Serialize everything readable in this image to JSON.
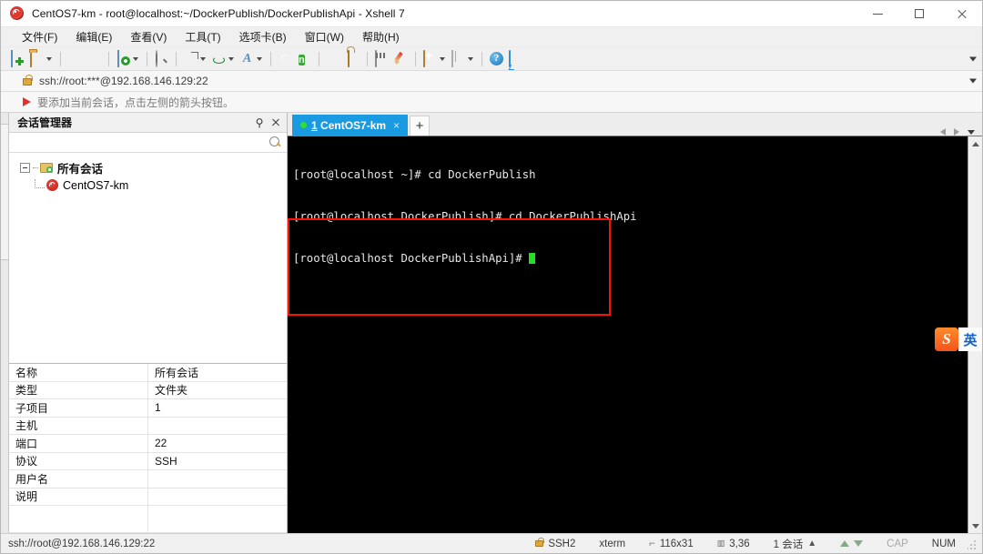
{
  "window": {
    "title": "CentOS7-km - root@localhost:~/DockerPublish/DockerPublishApi - Xshell 7",
    "app_icon": "xshell-spiral-icon",
    "minimize_label": "",
    "maximize_label": "",
    "close_label": ""
  },
  "menu": {
    "items": [
      {
        "label": "文件(F)",
        "name": "menu-file"
      },
      {
        "label": "编辑(E)",
        "name": "menu-edit"
      },
      {
        "label": "查看(V)",
        "name": "menu-view"
      },
      {
        "label": "工具(T)",
        "name": "menu-tools"
      },
      {
        "label": "选项卡(B)",
        "name": "menu-tabs"
      },
      {
        "label": "窗口(W)",
        "name": "menu-window"
      },
      {
        "label": "帮助(H)",
        "name": "menu-help"
      }
    ]
  },
  "toolbar": {
    "icons": [
      "new-session-icon",
      "open-folder-icon",
      "disconnect-icon",
      "link-icon",
      "session-properties-icon",
      "find-icon",
      "file-transfer-icon",
      "globe-icon",
      "font-icon",
      "xshell-icon",
      "nfs-icon",
      "fullscreen-icon",
      "lock-icon",
      "keyboard-icon",
      "highlight-pen-icon",
      "new-folder-icon",
      "layout-icon",
      "help-icon",
      "chat-icon"
    ],
    "nfs_glyph": "n",
    "font_glyph": "A",
    "help_glyph": "?",
    "overflow_name": "toolbar-overflow-chevron"
  },
  "address_bar": {
    "value": "ssh://root:***@192.168.146.129:22",
    "lock_icon": "lock-icon",
    "overflow_name": "address-overflow-chevron"
  },
  "hint_bar": {
    "text": "要添加当前会话，点击左侧的箭头按钮。",
    "icon": "red-flag-icon"
  },
  "sidebar": {
    "title": "会话管理器",
    "pin_label": "⚲",
    "close_label": "✕",
    "search": {
      "value": "",
      "placeholder": "",
      "icon": "search-icon"
    },
    "tree": {
      "root": {
        "label": "所有会话",
        "icon": "folder-sessions-icon",
        "expanded": true
      },
      "children": [
        {
          "label": "CentOS7-km",
          "icon": "xshell-session-icon"
        }
      ]
    },
    "properties": [
      {
        "key": "名称",
        "value": "所有会话"
      },
      {
        "key": "类型",
        "value": "文件夹"
      },
      {
        "key": "子项目",
        "value": "1"
      },
      {
        "key": "主机",
        "value": ""
      },
      {
        "key": "端口",
        "value": "22"
      },
      {
        "key": "协议",
        "value": "SSH"
      },
      {
        "key": "用户名",
        "value": ""
      },
      {
        "key": "说明",
        "value": ""
      }
    ]
  },
  "tabs": {
    "items": [
      {
        "index": "1",
        "label": "CentOS7-km",
        "active": true,
        "status_dot": "connected",
        "close_label": "×"
      }
    ],
    "new_tab_label": "+",
    "nav_prev": "tab-prev-arrow",
    "nav_next": "tab-next-arrow",
    "nav_list": "tab-list-chevron"
  },
  "terminal": {
    "lines": [
      "[root@localhost ~]# cd DockerPublish",
      "[root@localhost DockerPublish]# cd DockerPublishApi",
      "[root@localhost DockerPublishApi]# "
    ],
    "cursor_color": "#20e020",
    "background": "#000000",
    "foreground": "#e6e6e6"
  },
  "annotation": {
    "type": "rectangle-highlight",
    "color": "#fc1205"
  },
  "ime": {
    "logo_text": "S",
    "mode_text": "英"
  },
  "status_bar": {
    "left": "ssh://root@192.168.146.129:22",
    "protocol": "SSH2",
    "terminal_type": "xterm",
    "size": "116x31",
    "cursor_pos": "3,36",
    "sessions": "1 会话",
    "cap": "CAP",
    "num": "NUM",
    "size_icon": "terminal-size-icon",
    "pos_icon": "cursor-pos-icon"
  }
}
